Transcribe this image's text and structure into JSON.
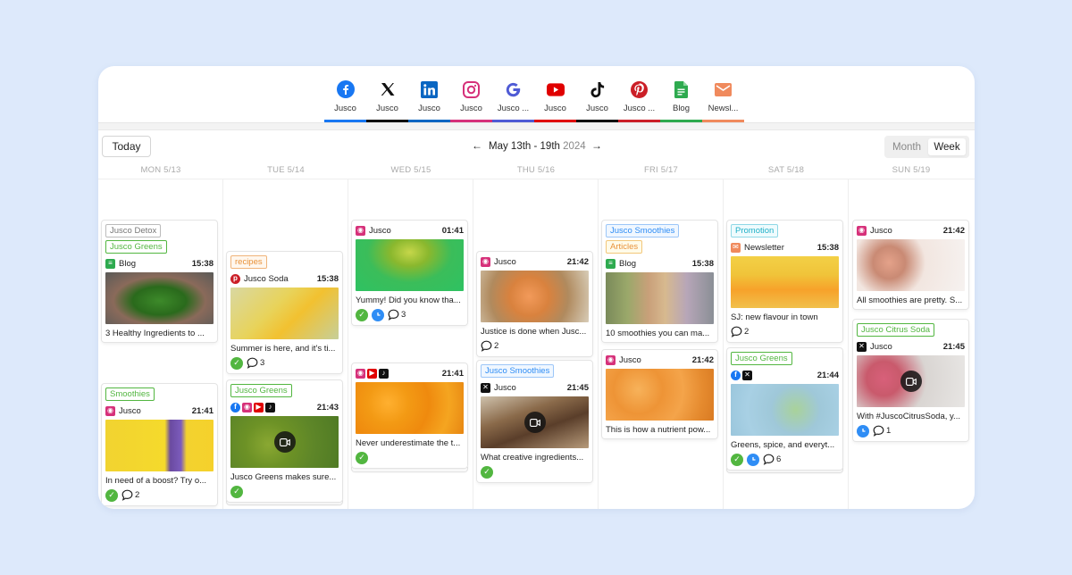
{
  "channels": [
    {
      "label": "Jusco",
      "icon": "facebook-icon",
      "color": "#1877f2"
    },
    {
      "label": "Jusco",
      "icon": "x-icon",
      "color": "#111111"
    },
    {
      "label": "Jusco",
      "icon": "linkedin-icon",
      "color": "#0a66c2"
    },
    {
      "label": "Jusco",
      "icon": "instagram-icon",
      "color": "#d6317a"
    },
    {
      "label": "Jusco ...",
      "icon": "google-icon",
      "color": "#4f5bd5"
    },
    {
      "label": "Jusco",
      "icon": "youtube-icon",
      "color": "#e00000"
    },
    {
      "label": "Jusco",
      "icon": "tiktok-icon",
      "color": "#111111"
    },
    {
      "label": "Jusco ...",
      "icon": "pinterest-icon",
      "color": "#cb1f27"
    },
    {
      "label": "Blog",
      "icon": "blog-doc-icon",
      "color": "#2eaa4f"
    },
    {
      "label": "Newsl...",
      "icon": "newsletter-mail-icon",
      "color": "#f08a5d"
    }
  ],
  "toolbar": {
    "today_label": "Today",
    "range": "May 13th - 19th",
    "year": "2024",
    "prev_icon": "arrow-left-icon",
    "next_icon": "arrow-right-icon",
    "month_label": "Month",
    "week_label": "Week"
  },
  "days": [
    "MON 5/13",
    "TUE 5/14",
    "WED 5/15",
    "THU 5/16",
    "FRI 5/17",
    "SAT 5/18",
    "SUN 5/19"
  ],
  "posts": {
    "mon1": {
      "tags": [
        "Jusco Detox",
        "Jusco Greens"
      ],
      "account": "Blog",
      "time": "15:38",
      "caption": "3 Healthy Ingredients to ..."
    },
    "mon2": {
      "tags": [
        "Smoothies"
      ],
      "account": "Jusco",
      "time": "21:41",
      "caption": "In need of a boost? Try o...",
      "comments": "2"
    },
    "tue1": {
      "tags": [
        "recipes"
      ],
      "account": "Jusco Soda",
      "time": "15:38",
      "caption": "Summer is here, and it's ti...",
      "comments": "3"
    },
    "tue2": {
      "tags": [
        "Jusco Greens"
      ],
      "time": "21:43",
      "caption": "Jusco Greens makes sure..."
    },
    "wed1": {
      "account": "Jusco",
      "time": "01:41",
      "caption": "Yummy! Did you know tha...",
      "comments": "3"
    },
    "wed2": {
      "time": "21:41",
      "caption": "Never underestimate the t..."
    },
    "thu1": {
      "account": "Jusco",
      "time": "21:42",
      "caption": "Justice is done when Jusc...",
      "comments": "2"
    },
    "thu2": {
      "tags": [
        "Jusco Smoothies"
      ],
      "account": "Jusco",
      "time": "21:45",
      "caption": "What creative ingredients..."
    },
    "fri1": {
      "tags": [
        "Jusco Smoothies",
        "Articles"
      ],
      "account": "Blog",
      "time": "15:38",
      "caption": "10 smoothies you can ma..."
    },
    "fri2": {
      "account": "Jusco",
      "time": "21:42",
      "caption": "This is how a nutrient pow..."
    },
    "sat1": {
      "tags": [
        "Promotion"
      ],
      "account": "Newsletter",
      "time": "15:38",
      "caption": "SJ: new flavour in town",
      "comments": "2"
    },
    "sat2": {
      "tags": [
        "Jusco Greens"
      ],
      "time": "21:44",
      "caption": "Greens, spice, and everyt...",
      "comments": "6"
    },
    "sun1": {
      "account": "Jusco",
      "time": "21:42",
      "caption": "All smoothies are pretty. S..."
    },
    "sun2": {
      "tags": [
        "Jusco Citrus Soda"
      ],
      "account": "Jusco",
      "time": "21:45",
      "caption": "With #JuscoCitrusSoda, y...",
      "comments": "1"
    }
  },
  "tag_colors": {
    "grey": "#777777",
    "green": "#52b640",
    "orange": "#e8923a",
    "blue": "#2f8df5",
    "teal": "#20b0c8"
  }
}
